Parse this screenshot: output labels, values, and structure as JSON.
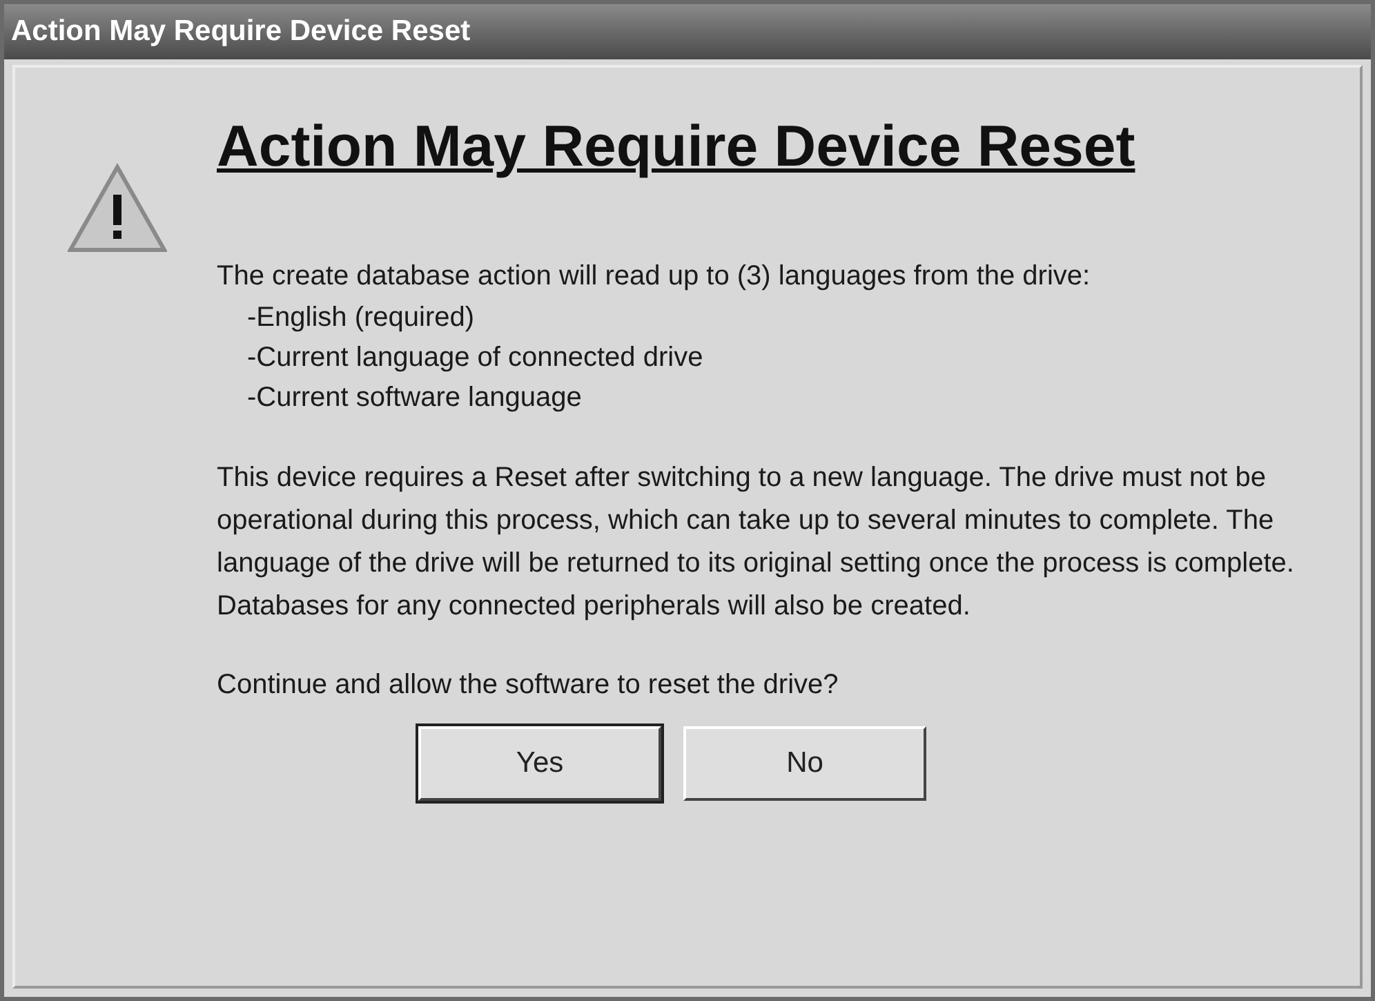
{
  "window": {
    "title": "Action May Require Device Reset"
  },
  "heading": "Action May Require Device Reset",
  "intro": "The create database action will read up to (3) languages from the drive:",
  "languages": [
    "-English (required)",
    "-Current language of connected drive",
    "-Current software language"
  ],
  "paragraph": "This device requires a Reset after switching to a new language.  The drive must not be operational during this process, which can take up to several minutes to complete.  The language of the drive will be returned to its original setting once the process is complete.  Databases for any connected peripherals will also be created.",
  "question": "Continue and allow the software to reset the drive?",
  "buttons": [
    {
      "label": "Yes",
      "default": true
    },
    {
      "label": "No",
      "default": false
    }
  ]
}
